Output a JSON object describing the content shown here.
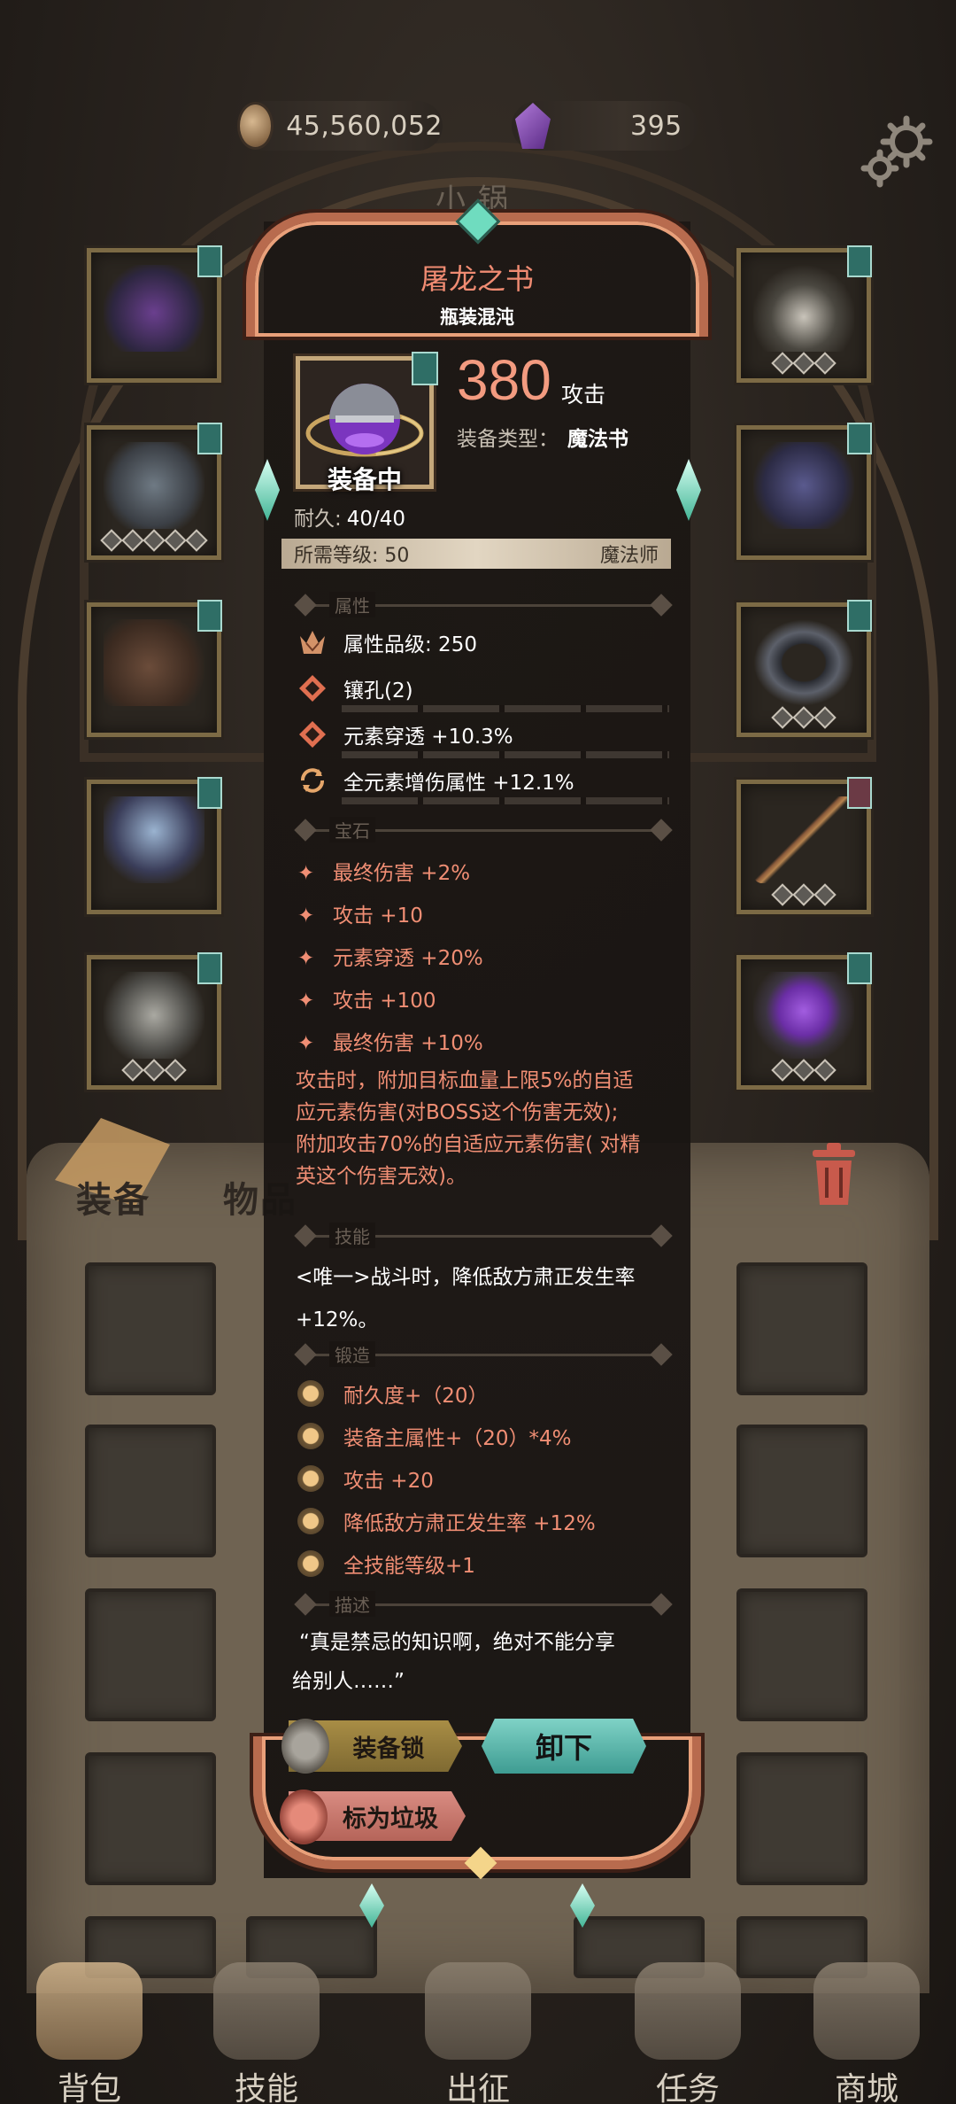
{
  "top_bar": {
    "gold": "45,560,052",
    "gems": "395",
    "gold_icon": "coin-icon",
    "gem_icon": "purple-gem-icon",
    "settings_icon": "gear-icon"
  },
  "character_name": "小锅",
  "item": {
    "name": "屠龙之书",
    "subtitle": "瓶装混沌",
    "equipped_label": "装备中",
    "attack_value": "380",
    "attack_label": "攻击",
    "type_label": "装备类型：",
    "type_value": "魔法书",
    "durability_label": "耐久:",
    "durability_value": "40/40",
    "required_level": "所需等级: 50",
    "required_class": "魔法师"
  },
  "sections": {
    "attributes": "属性",
    "gems": "宝石",
    "skills": "技能",
    "forge": "锻造",
    "description": "描述"
  },
  "attributes": [
    {
      "text": "属性品级: 250",
      "icon": "crown-icon"
    },
    {
      "text": "镶孔(2)",
      "icon": "socket-icon"
    },
    {
      "text": "元素穿透 +10.3%",
      "icon": "socket-icon"
    },
    {
      "text": "全元素增伤属性 +12.1%",
      "icon": "cycle-icon"
    }
  ],
  "gem_stats": [
    "最终伤害 +2%",
    "攻击 +10",
    "元素穿透 +20%",
    "攻击 +100",
    "最终伤害 +10%"
  ],
  "gem_effect_lines": [
    "攻击时，附加目标血量上限5%的自适",
    "应元素伤害(对BOSS这个伤害无效);",
    "附加攻击70%的自适应元素伤害( 对精",
    "英这个伤害无效)。"
  ],
  "skill_lines": [
    "<唯一>战斗时，降低敌方肃正发生率",
    "+12%。"
  ],
  "forge_stats": [
    "耐久度+（20）",
    "装备主属性+（20）*4%",
    "攻击 +20",
    "降低敌方肃正发生率 +12%",
    "全技能等级+1"
  ],
  "description_lines": [
    "“真是禁忌的知识啊，绝对不能分享",
    "给别人……”"
  ],
  "buttons": {
    "lock": "装备锁",
    "unequip": "卸下",
    "mark_trash": "标为垃圾"
  },
  "bag_tabs": {
    "equipment": "装备",
    "items": "物品"
  },
  "bottom_nav": [
    {
      "label": "背包",
      "icon": "backpack-icon"
    },
    {
      "label": "技能",
      "icon": "skill-book-icon"
    },
    {
      "label": "出征",
      "icon": "battle-icon"
    },
    {
      "label": "任务",
      "icon": "scroll-icon"
    },
    {
      "label": "商城",
      "icon": "shop-icon"
    }
  ],
  "colors": {
    "accent_orange": "#f08e74",
    "frame_copper": "#b86b4e",
    "teal_button": "#5bbdb1",
    "gold_button": "#a88d45",
    "trash_button": "#d98c82"
  }
}
